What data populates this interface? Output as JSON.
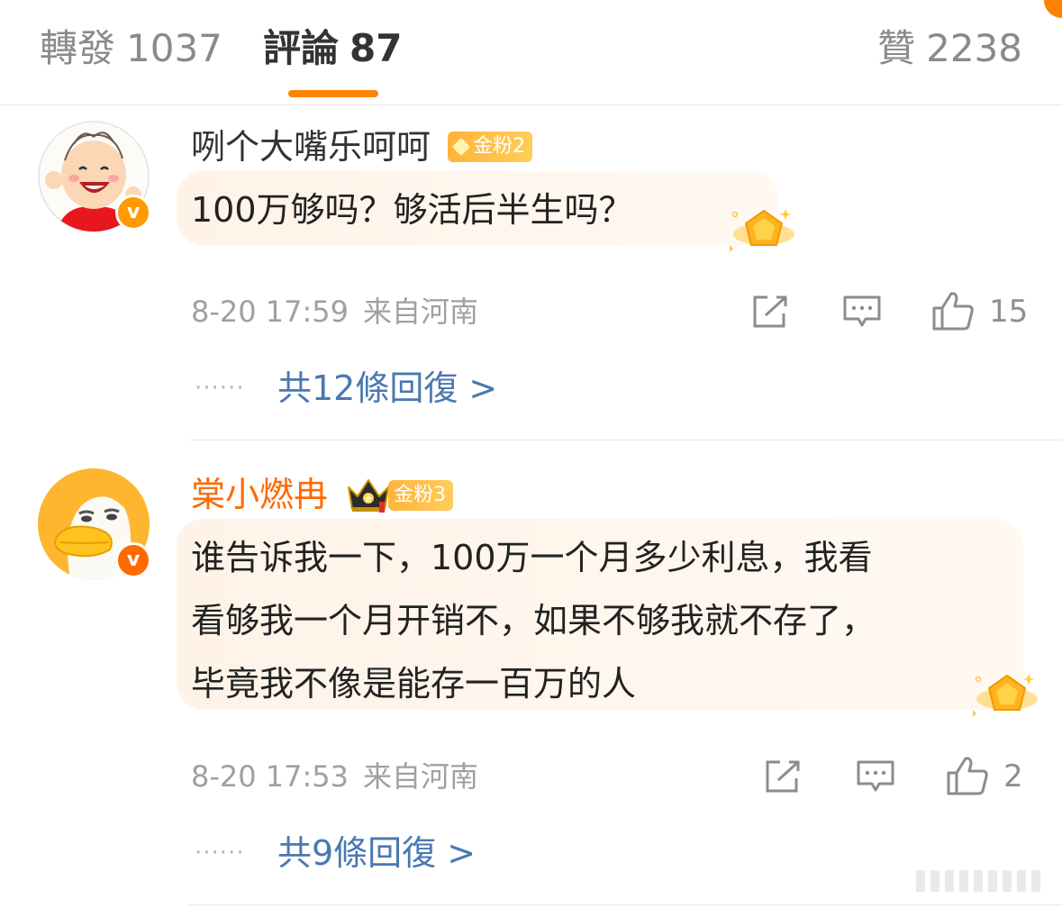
{
  "tabs": {
    "repost": {
      "label": "轉發",
      "count": "1037"
    },
    "comments": {
      "label": "評論",
      "count": "87"
    },
    "likes": {
      "label": "贊",
      "count": "2238"
    }
  },
  "colors": {
    "accent": "#ff8200",
    "link": "#4a78b0",
    "vip_name": "#ff6a00"
  },
  "comments": [
    {
      "username": "咧个大嘴乐呵呵",
      "fan_badge": "金粉2",
      "text": "100万够吗？够活后半生吗？",
      "time": "8-20 17:59",
      "location": "来自河南",
      "likes": "15",
      "replies": "共12條回復 >",
      "verified_icon": "v-badge-icon"
    },
    {
      "username": "棠小燃冉",
      "fan_badge": "金粉3",
      "text": "谁告诉我一下，100万一个月多少利息，我看\n看够我一个月开销不，如果不够我就不存了，\n毕竟我不像是能存一百万的人",
      "time": "8-20 17:53",
      "location": "来自河南",
      "likes": "2",
      "replies": "共9條回復 >",
      "verified_icon": "v-badge-icon"
    }
  ],
  "reply_dots": "······",
  "icons": {
    "share": "share-icon",
    "comment": "comment-icon",
    "like": "thumbs-up-icon",
    "crown": "crown-icon",
    "bubble_deco": "gold-gem-icon"
  }
}
